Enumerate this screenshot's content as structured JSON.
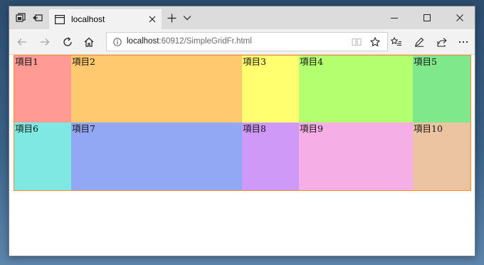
{
  "browser": {
    "tab_title": "localhost",
    "address_host": "localhost",
    "address_path": ":60912/SimpleGridFr.html"
  },
  "grid": {
    "items": [
      {
        "label": "項目1",
        "color": "#ff9a94"
      },
      {
        "label": "項目2",
        "color": "#ffc970"
      },
      {
        "label": "項目3",
        "color": "#ffff70"
      },
      {
        "label": "項目4",
        "color": "#b3ff70"
      },
      {
        "label": "項目5",
        "color": "#7fe88a"
      },
      {
        "label": "項目6",
        "color": "#7fe8e2"
      },
      {
        "label": "項目7",
        "color": "#92a8f5"
      },
      {
        "label": "項目8",
        "color": "#cf99f7"
      },
      {
        "label": "項目9",
        "color": "#f5aee6"
      },
      {
        "label": "項目10",
        "color": "#ecc4a2"
      }
    ],
    "border_color": "#ff8a1f"
  }
}
